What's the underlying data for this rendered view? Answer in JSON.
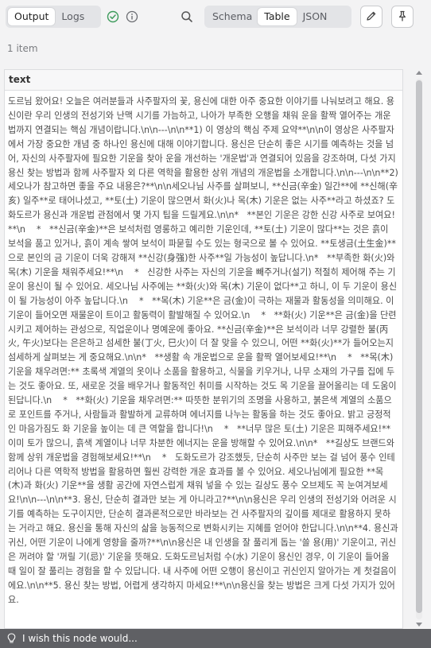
{
  "toolbar": {
    "output_tabs": [
      {
        "label": "Output",
        "active": true
      },
      {
        "label": "Logs",
        "active": false
      }
    ],
    "view_tabs": [
      {
        "label": "Schema",
        "active": false
      },
      {
        "label": "Table",
        "active": true
      },
      {
        "label": "JSON",
        "active": false
      }
    ],
    "icons": {
      "success": "check-circle-icon",
      "info": "info-icon",
      "search": "search-icon",
      "edit": "pencil-icon",
      "pin": "pin-icon"
    }
  },
  "item_count": "1 item",
  "table": {
    "column": "text",
    "cell": "도르님 왔어요! 오늘은 여러분들과 사주팔자의 꽃, 용신에 대한 아주 중요한 이야기를 나눠보려고 해요. 용신이란 우리 인생의 전성기와 난맥 시기를 가늠하고, 나아가 부족한 오행을 채워 운을 활짝 열어주는 개운법까지 연결되는 핵심 개념이랍니다.\\n\\n---\\n\\n**1) 이 영상의 핵심 주제 요약**\\n\\n이 영상은 사주팔자에서 가장 중요한 개념 중 하나인 용신에 대해 이야기합니다. 용신은 단순히 좋은 시기를 예측하는 것을 넘어, 자신의 사주팔자에 필요한 기운을 찾아 운을 개선하는 '개운법'과 연결되어 있음을 강조하며, 다섯 가지 용신 찾는 방법과 함께 사주팔자 외 다른 역학을 활용한 상위 개념의 개운법을 소개합니다.\\n\\n---\\n\\n**2) 세오나가 참고하면 좋을 주요 내용은?**\\n\\n세오나님 사주를 살펴보니, **신금(辛金) 일간**에 **신해(辛亥) 일주**로 태어나셨고, **토(土) 기운이 많으면서 화(火)나 목(木) 기운은 없는 사주**라고 하셨죠? 도화도르가 용신과 개운법 관점에서 몇 가지 팁을 드릴게요.\\n\\n*   **본인 기운은 강한 신강 사주로 보여요!**\\n    *   **신금(辛金)**은 보석처럼 영롱하고 예리한 기운인데, **토(土) 기운이 많다**는 것은 흙이 보석을 품고 있거나, 흙이 계속 쌓여 보석이 파묻힐 수도 있는 형국으로 볼 수 있어요. **토생금(土生金)**으로 본인의 금 기운이 더욱 강해져 **신강(身强)한 사주**일 가능성이 높답니다.\\n*   **부족한 화(火)와 목(木) 기운을 채워주세요!**\\n    *   신강한 사주는 자신의 기운을 빼주거나(설기) 적절히 제어해 주는 기운이 용신이 될 수 있어요. 세오나님 사주에는 **화(火)와 목(木) 기운이 없다**고 하니, 이 두 기운이 용신이 될 가능성이 아주 높답니다.\\n    *   **목(木) 기운**은 금(金)이 극하는 재물과 활동성을 의미해요. 이 기운이 들어오면 재물운이 트이고 활동력이 활발해질 수 있어요.\\n    *   **화(火) 기운**은 금(金)을 단련시키고 제어하는 관성으로, 직업운이나 명예운에 좋아요. **신금(辛金)**은 보석이라 너무 강렬한 불(丙火, 午火)보다는 은은하고 섬세한 불(丁火, 巳火)이 더 잘 맞을 수 있으니, 어떤 **화(火)**가 들어오는지 섬세하게 살펴보는 게 중요해요.\\n\\n*   **생활 속 개운법으로 운을 활짝 열어보세요!**\\n    *   **목(木) 기운을 채우려면:** 초록색 계열의 옷이나 소품을 활용하고, 식물을 키우거나, 나무 소재의 가구를 집에 두는 것도 좋아요. 또, 새로운 것을 배우거나 활동적인 취미를 시작하는 것도 목 기운을 끌어올리는 데 도움이 된답니다.\\n    *   **화(火) 기운을 채우려면:** 따뜻한 분위기의 조명을 사용하고, 붉은색 계열의 소품으로 포인트를 주거나, 사람들과 활발하게 교류하며 에너지를 나누는 활동을 하는 것도 좋아요. 밝고 긍정적인 마음가짐도 화 기운을 높이는 데 큰 역할을 합니다!\\n    *   **너무 많은 토(土) 기운은 피해주세요!** 이미 토가 많으니, 흙색 계열이나 너무 차분한 에너지는 운을 방해할 수 있어요.\\n\\n*   **길상도 브랜드와 함께 상위 개운법을 경험해보세요!**\\n    *   도화도르가 강조했듯, 단순히 사주만 보는 걸 넘어 풍수 인테리어나 다른 역학적 방법을 활용하면 훨씬 강력한 개운 효과를 볼 수 있어요. 세오나님에게 필요한 **목(木)과 화(火) 기운**을 생활 공간에 자연스럽게 채워 넣을 수 있는 길상도 풍수 오브제도 꼭 눈여겨보세요!\\n\\n---\\n\\n**3. 용신, 단순히 결과만 보는 게 아니라고?**\\n\\n용신은 우리 인생의 전성기와 어려운 시기를 예측하는 도구이지만, 단순히 결과론적으로만 바라보는 건 사주팔자의 깊이를 제대로 활용하지 못하는 거라고 해요. 용신을 통해 자신의 삶을 능동적으로 변화시키는 지혜를 얻어야 한답니다.\\n\\n**4. 용신과 귀신, 어떤 기운이 나에게 영향을 줄까?**\\n\\n용신은 내 인생을 잘 풀리게 돕는 '쓸 용(用)' 기운이고, 귀신은 꺼려야 할 '꺼릴 기(忌)' 기운을 뜻해요. 도화도르님처럼 수(水) 기운이 용신인 경우, 이 기운이 들어올 때 일이 잘 풀리는 경험을 할 수 있답니다. 내 사주에 어떤 오행이 용신이고 귀신인지 알아가는 게 첫걸음이에요.\\n\\n**5. 용신 찾는 방법, 어렵게 생각하지 마세요!**\\n\\n용신을 찾는 방법은 크게 다섯 가지가 있어요."
  },
  "footer": {
    "prompt": "I wish this node would...",
    "icon": "lightbulb-icon"
  }
}
